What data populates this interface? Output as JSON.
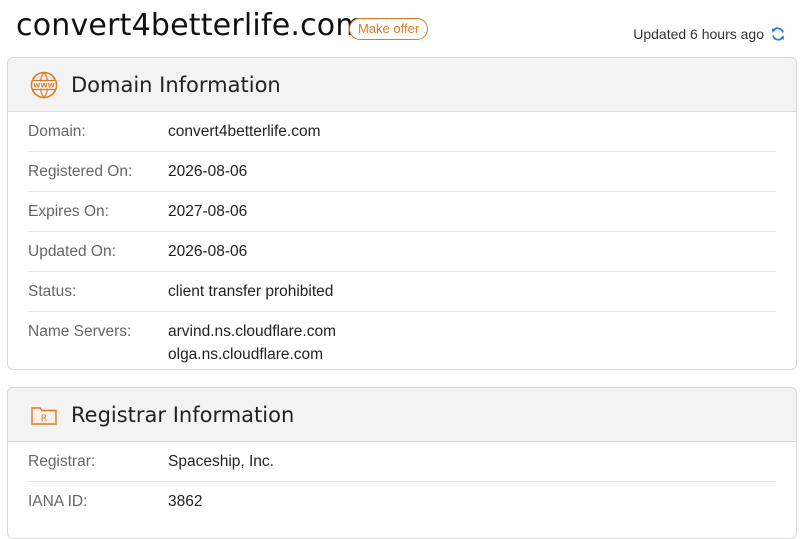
{
  "header": {
    "domain": "convert4betterlife.com",
    "make_offer_label": "Make offer",
    "updated_text": "Updated 6 hours ago"
  },
  "domain_info": {
    "title": "Domain Information",
    "icon": "www-globe-icon",
    "rows": [
      {
        "label": "Domain:",
        "value": "convert4betterlife.com"
      },
      {
        "label": "Registered On:",
        "value": "2026-08-06"
      },
      {
        "label": "Expires On:",
        "value": "2027-08-06"
      },
      {
        "label": "Updated On:",
        "value": "2026-08-06"
      },
      {
        "label": "Status:",
        "value": "client transfer prohibited"
      }
    ],
    "name_servers": {
      "label": "Name Servers:",
      "values": [
        "arvind.ns.cloudflare.com",
        "olga.ns.cloudflare.com"
      ]
    }
  },
  "registrar_info": {
    "title": "Registrar Information",
    "icon": "registrar-folder-icon",
    "rows": [
      {
        "label": "Registrar:",
        "value": "Spaceship, Inc."
      },
      {
        "label": "IANA ID:",
        "value": "3862"
      }
    ]
  },
  "colors": {
    "accent": "#e07a22",
    "refresh": "#2a7ed6"
  }
}
